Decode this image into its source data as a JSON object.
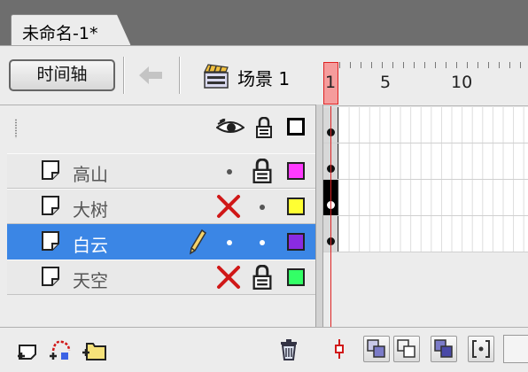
{
  "document_tab": {
    "title": "未命名-1*"
  },
  "toolbar": {
    "timeline_label": "时间轴",
    "scene_label": "场景 1"
  },
  "layers": [
    {
      "name": "高山",
      "visible_state": "dot",
      "lock_state": "locked",
      "color": "#ff3bff",
      "selected": false
    },
    {
      "name": "大树",
      "visible_state": "hidden",
      "lock_state": "dot",
      "color": "#ffff33",
      "selected": false
    },
    {
      "name": "白云",
      "visible_state": "dot",
      "lock_state": "dot",
      "color": "#8a2be2",
      "selected": true,
      "editing": true
    },
    {
      "name": "天空",
      "visible_state": "hidden",
      "lock_state": "locked",
      "color": "#33ff66",
      "selected": false
    }
  ],
  "ruler": {
    "current_frame": "1",
    "labels": [
      "5",
      "10"
    ]
  },
  "icons": {
    "eye": "eye-icon",
    "lock": "lock-icon",
    "outline": "outline-icon",
    "hidden": "x-icon",
    "pencil": "pencil-icon",
    "trash": "trash-icon"
  }
}
